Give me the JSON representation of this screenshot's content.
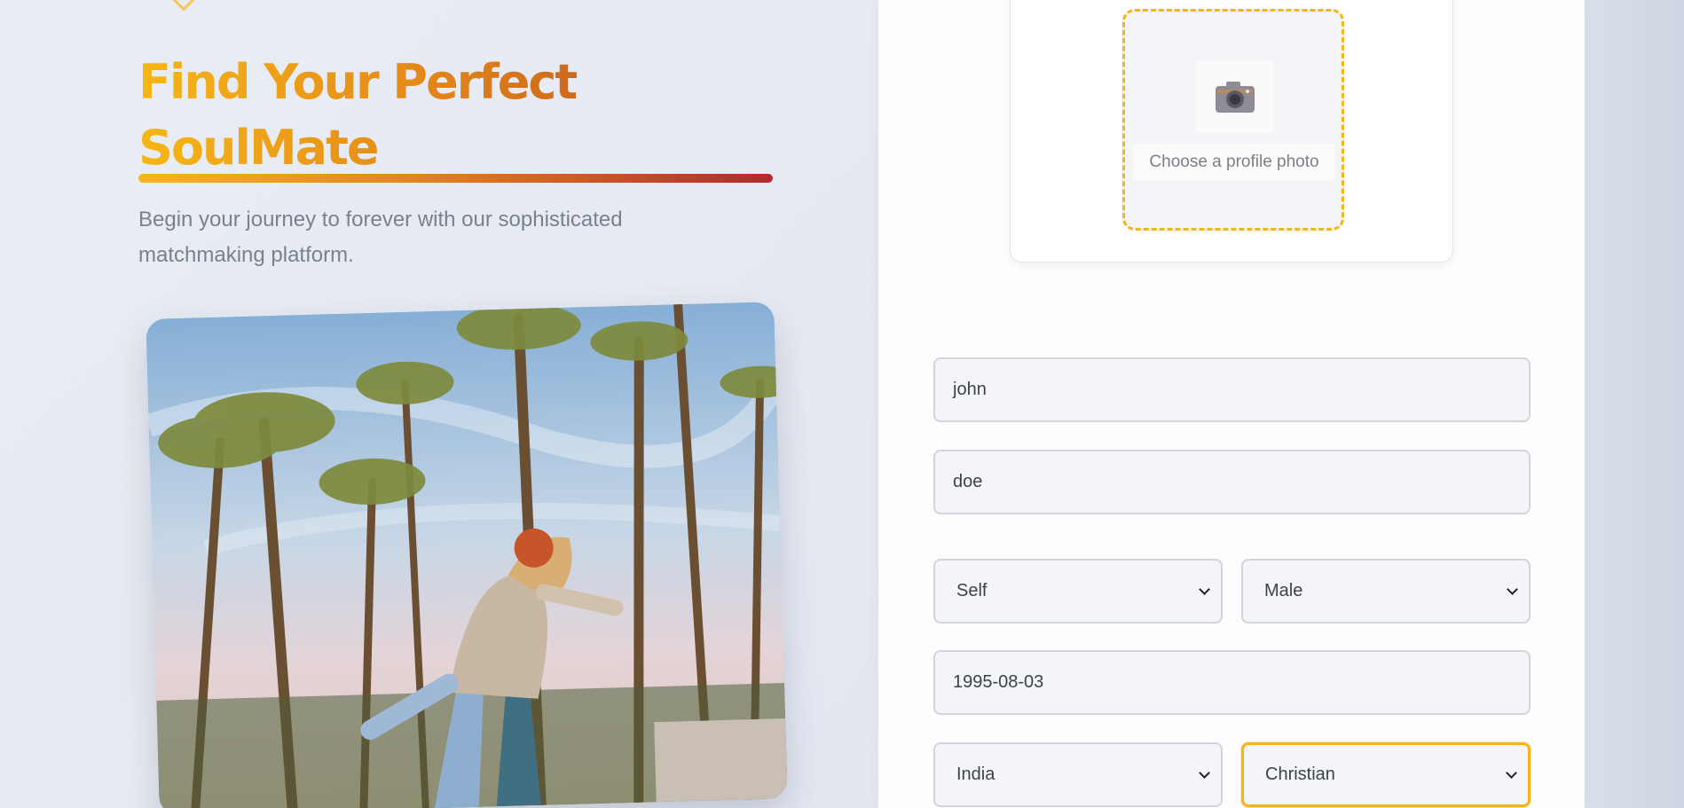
{
  "hero": {
    "title_line1": "Find Your Perfect",
    "title_line2": "SoulMate",
    "subtitle": "Begin your journey to forever with our sophisticated matchmaking platform."
  },
  "upload": {
    "label": "Choose a profile photo",
    "icon": "camera-icon"
  },
  "form": {
    "first_name": "john",
    "last_name": "doe",
    "profile_for": "Self",
    "gender": "Male",
    "dob": "1995-08-03",
    "country": "India",
    "religion": "Christian"
  },
  "colors": {
    "accent": "#f5b51a",
    "title_gradient_start": "#f7b617",
    "title_gradient_end": "#c75d1d",
    "underline_end": "#b3282f"
  }
}
